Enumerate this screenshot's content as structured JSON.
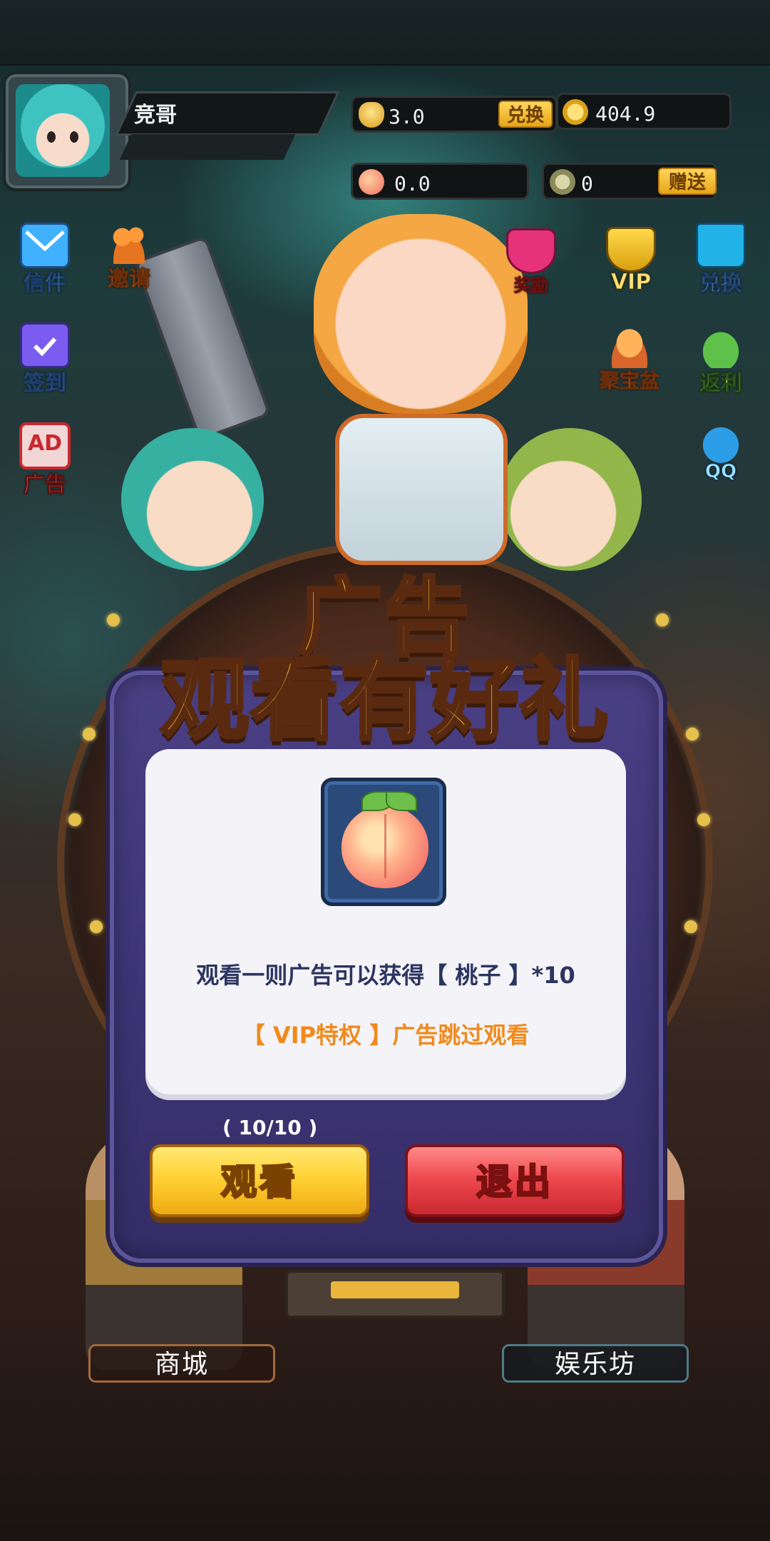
{
  "player": {
    "name": "竞哥"
  },
  "currencies": {
    "ingot": {
      "value": "3.0",
      "action": "兑换"
    },
    "coin": {
      "value": "404.9"
    },
    "peach": {
      "value": "0.0"
    },
    "gift": {
      "value": "0",
      "action": "赠送"
    }
  },
  "left_menu": [
    {
      "label": "信件",
      "icon": "mail-icon"
    },
    {
      "label": "邀请",
      "icon": "invite-icon"
    },
    {
      "label": "签到",
      "icon": "calendar-icon"
    },
    {
      "label": "广告",
      "icon": "ad-icon",
      "badge": "AD"
    }
  ],
  "right_menu": [
    {
      "label": "奖励",
      "icon": "gem-icon"
    },
    {
      "label": "VIP",
      "icon": "vip-crown-icon"
    },
    {
      "label": "兑换",
      "icon": "shopping-bag-icon"
    },
    {
      "label": "聚宝盆",
      "icon": "treasure-bowl-icon"
    },
    {
      "label": "返利",
      "icon": "money-bag-icon"
    },
    {
      "label": "QQ",
      "icon": "qq-penguin-icon"
    }
  ],
  "popup": {
    "title_line1": "广告",
    "title_line2": "观看有好礼",
    "reward_icon": "peach-icon",
    "description": "观看一则广告可以获得【 桃子 】*10",
    "vip_note": "【 VIP特权 】广告跳过观看",
    "counter": "( 10/10 )",
    "watch_button": "观看",
    "exit_button": "退出"
  },
  "bottom_tabs": {
    "shop": "商城",
    "entertainment": "娱乐坊"
  },
  "colors": {
    "dialog": "#3d3474",
    "watch_button": "#ffd235",
    "exit_button": "#ef4b4f",
    "vip_note": "#f08a1c",
    "title": "#ffc83a"
  }
}
